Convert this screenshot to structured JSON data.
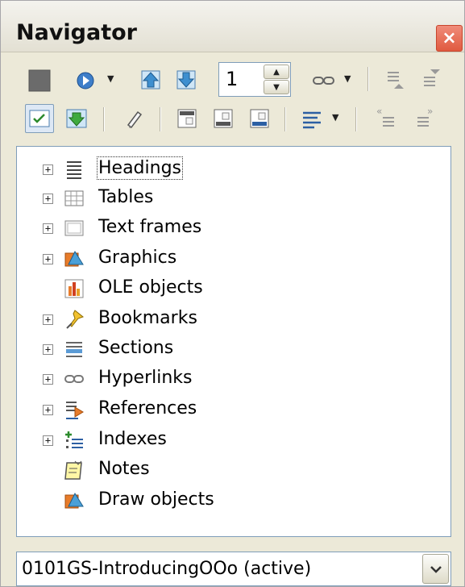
{
  "window": {
    "title": "Navigator",
    "close_glyph": "×"
  },
  "toolbar1": {
    "page_number": "1",
    "items": [
      "content-view-icon",
      "navigation-icon",
      "previous-icon",
      "next-icon",
      "page-spin",
      "drag-mode-icon",
      "promote-level-icon",
      "demote-level-icon"
    ]
  },
  "toolbar2": {
    "items": [
      "list-box-toggle-icon",
      "content-navigation-icon",
      "edit-icon",
      "header-icon",
      "footer-icon",
      "anchor-icon",
      "heading-levels-icon",
      "promote-chapter-icon",
      "demote-chapter-icon"
    ]
  },
  "tree": {
    "items": [
      {
        "label": "Headings",
        "icon": "headings-icon",
        "expandable": true
      },
      {
        "label": "Tables",
        "icon": "tables-icon",
        "expandable": true
      },
      {
        "label": "Text frames",
        "icon": "text-frames-icon",
        "expandable": true
      },
      {
        "label": "Graphics",
        "icon": "graphics-icon",
        "expandable": true
      },
      {
        "label": "OLE objects",
        "icon": "ole-objects-icon",
        "expandable": false
      },
      {
        "label": "Bookmarks",
        "icon": "bookmarks-icon",
        "expandable": true
      },
      {
        "label": "Sections",
        "icon": "sections-icon",
        "expandable": true
      },
      {
        "label": "Hyperlinks",
        "icon": "hyperlinks-icon",
        "expandable": true
      },
      {
        "label": "References",
        "icon": "references-icon",
        "expandable": true
      },
      {
        "label": "Indexes",
        "icon": "indexes-icon",
        "expandable": true
      },
      {
        "label": "Notes",
        "icon": "notes-icon",
        "expandable": false
      },
      {
        "label": "Draw objects",
        "icon": "draw-objects-icon",
        "expandable": false
      }
    ],
    "expander_glyph": "+"
  },
  "document_select": {
    "value": "0101GS-IntroducingOOo (active)"
  },
  "colors": {
    "close_button": "#e05a3f",
    "background": "#ece9d8",
    "field_border": "#7f9db9"
  }
}
